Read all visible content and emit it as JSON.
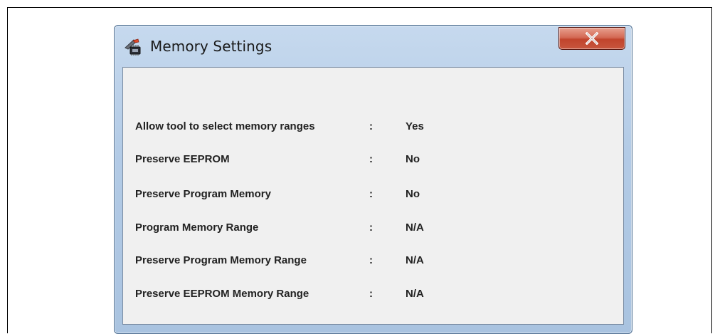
{
  "window": {
    "title": "Memory Settings",
    "close_label": "X"
  },
  "settings": [
    {
      "label": "Allow tool to select memory ranges",
      "separator": ":",
      "value": "Yes"
    },
    {
      "label": "Preserve EEPROM",
      "separator": ":",
      "value": "No"
    },
    {
      "label": "Preserve Program Memory",
      "separator": ":",
      "value": "No"
    },
    {
      "label": "Program Memory Range",
      "separator": ":",
      "value": "N/A"
    },
    {
      "label": "Preserve Program Memory Range",
      "separator": ":",
      "value": "N/A"
    },
    {
      "label": "Preserve EEPROM Memory Range",
      "separator": ":",
      "value": "N/A"
    }
  ],
  "icons": {
    "app": "programmer-tool-icon",
    "close": "close-icon"
  }
}
